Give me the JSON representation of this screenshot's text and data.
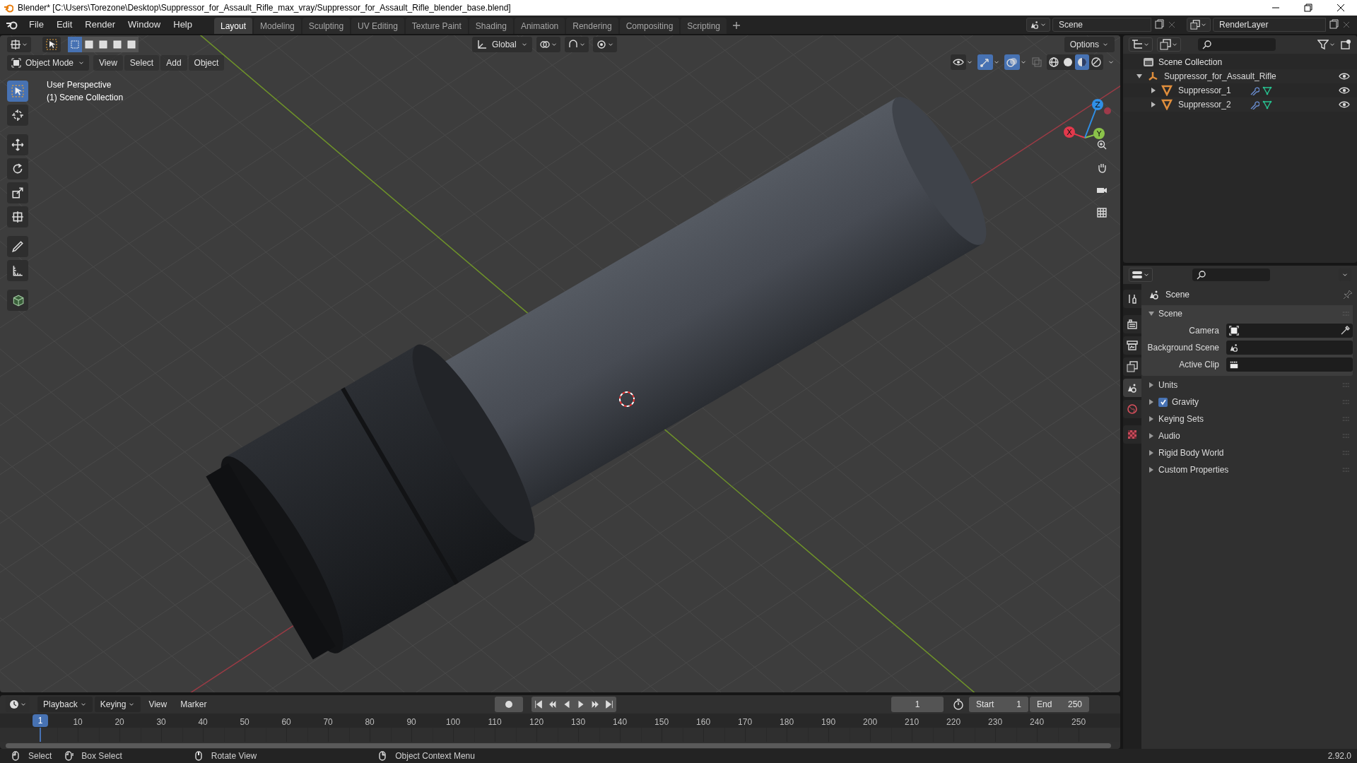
{
  "window": {
    "title": "Blender* [C:\\Users\\Torezone\\Desktop\\Suppressor_for_Assault_Rifle_max_vray/Suppressor_for_Assault_Rifle_blender_base.blend]"
  },
  "menu_bar": {
    "items": [
      "File",
      "Edit",
      "Render",
      "Window",
      "Help"
    ]
  },
  "workspace_tabs": [
    {
      "label": "Layout",
      "selected": true
    },
    {
      "label": "Modeling",
      "selected": false
    },
    {
      "label": "Sculpting",
      "selected": false
    },
    {
      "label": "UV Editing",
      "selected": false
    },
    {
      "label": "Texture Paint",
      "selected": false
    },
    {
      "label": "Shading",
      "selected": false
    },
    {
      "label": "Animation",
      "selected": false
    },
    {
      "label": "Rendering",
      "selected": false
    },
    {
      "label": "Compositing",
      "selected": false
    },
    {
      "label": "Scripting",
      "selected": false
    }
  ],
  "scene_selector": {
    "value": "Scene"
  },
  "view_layer_selector": {
    "value": "RenderLayer"
  },
  "tool_header": {
    "select_modes": [
      {
        "selected": true
      },
      {
        "selected": false
      },
      {
        "selected": false
      },
      {
        "selected": false
      },
      {
        "selected": false
      }
    ],
    "transform_orientation": "Global",
    "options_label": "Options"
  },
  "viewport_header": {
    "mode": "Object Mode",
    "menus": [
      "View",
      "Select",
      "Add",
      "Object"
    ],
    "shading_modes": [
      {
        "kind": "wireframe",
        "selected": false
      },
      {
        "kind": "solid",
        "selected": false
      },
      {
        "kind": "material",
        "selected": true
      },
      {
        "kind": "rendered",
        "selected": false
      }
    ]
  },
  "viewport": {
    "info": [
      "User Perspective",
      "(1) Scene Collection"
    ],
    "gizmo_axes": [
      {
        "label": "X",
        "color": "#e2394c"
      },
      {
        "label": "Y",
        "color": "#8bc34a"
      },
      {
        "label": "Z",
        "color": "#2f8fe6"
      }
    ]
  },
  "toolbar": {
    "tools": [
      {
        "kind": "select-box",
        "selected": true
      },
      {
        "kind": "cursor",
        "selected": false
      },
      {
        "kind": "move",
        "selected": false
      },
      {
        "kind": "rotate",
        "selected": false
      },
      {
        "kind": "scale",
        "selected": false
      },
      {
        "kind": "transform",
        "selected": false
      },
      {
        "kind": "annotate",
        "selected": false
      },
      {
        "kind": "measure",
        "selected": false
      },
      {
        "kind": "add-cube",
        "selected": false
      }
    ]
  },
  "outliner": {
    "root": "Scene Collection",
    "items": [
      {
        "label": "Suppressor_for_Assault_Rifle",
        "expanded": true,
        "visible": true,
        "children": [
          {
            "label": "Suppressor_1",
            "expanded": false,
            "visible": true
          },
          {
            "label": "Suppressor_2",
            "expanded": false,
            "visible": true
          }
        ]
      }
    ]
  },
  "properties": {
    "tabs": [
      {
        "kind": "tool",
        "selected": false
      },
      {
        "kind": "render",
        "selected": false
      },
      {
        "kind": "output",
        "selected": false
      },
      {
        "kind": "view-layer",
        "selected": false
      },
      {
        "kind": "scene",
        "selected": true
      },
      {
        "kind": "world",
        "selected": false
      },
      {
        "kind": "texture",
        "selected": false
      }
    ],
    "context": "Scene",
    "panels": [
      {
        "label": "Scene",
        "kind": "plain",
        "expanded": true,
        "fields": [
          {
            "label": "Camera",
            "kind": "camera"
          },
          {
            "label": "Background Scene",
            "kind": "scene"
          },
          {
            "label": "Active Clip",
            "kind": "clip"
          }
        ]
      },
      {
        "label": "Units",
        "kind": "plain",
        "expanded": false
      },
      {
        "label": "Gravity",
        "kind": "checkbox",
        "checked": true,
        "expanded": false
      },
      {
        "label": "Keying Sets",
        "kind": "plain",
        "expanded": false
      },
      {
        "label": "Audio",
        "kind": "plain",
        "expanded": false
      },
      {
        "label": "Rigid Body World",
        "kind": "plain",
        "expanded": false
      },
      {
        "label": "Custom Properties",
        "kind": "plain",
        "expanded": false
      }
    ]
  },
  "timeline": {
    "menus": [
      "Playback",
      "Keying",
      "View",
      "Marker"
    ],
    "current_frame": "1",
    "start_label": "Start",
    "start": "1",
    "end_label": "End",
    "end": "250",
    "playhead": "1",
    "ticks": [
      "10",
      "20",
      "30",
      "40",
      "50",
      "60",
      "70",
      "80",
      "90",
      "100",
      "110",
      "120",
      "130",
      "140",
      "150",
      "160",
      "170",
      "180",
      "190",
      "200",
      "210",
      "220",
      "230",
      "240",
      "250"
    ]
  },
  "status_bar": {
    "hints": [
      {
        "kind": "left",
        "label": "Select"
      },
      {
        "kind": "left-drag",
        "label": "Box Select"
      },
      {
        "kind": "middle",
        "label": "Rotate View"
      },
      {
        "kind": "right",
        "label": "Object Context Menu"
      }
    ],
    "version": "2.92.0"
  }
}
